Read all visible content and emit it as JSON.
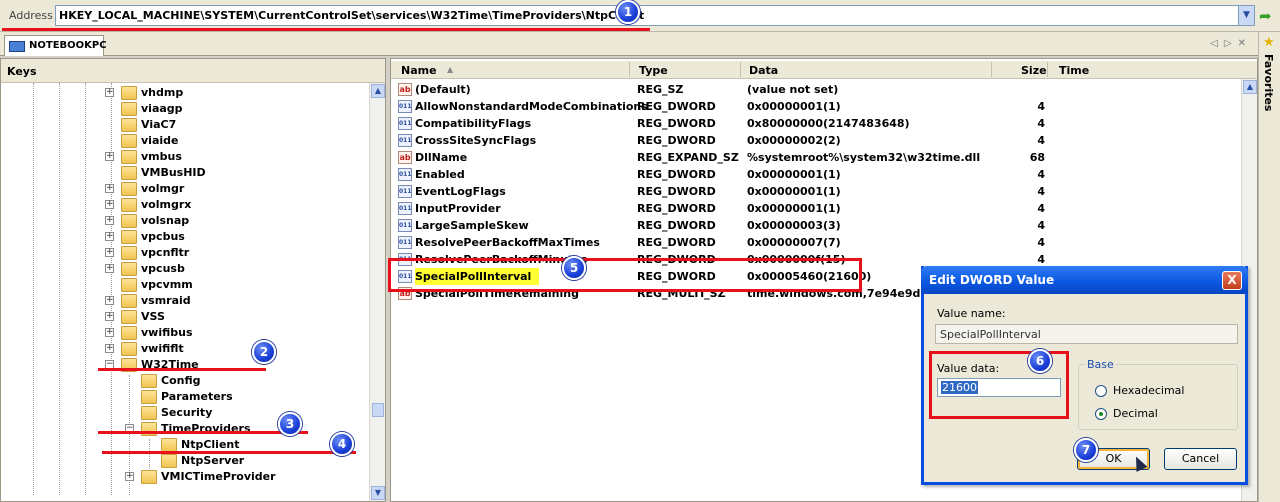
{
  "address": {
    "label": "Address",
    "path": "HKEY_LOCAL_MACHINE\\SYSTEM\\CurrentControlSet\\services\\W32Time\\TimeProviders\\NtpClient"
  },
  "tab": {
    "label": "NOTEBOOKPC"
  },
  "favorites": {
    "label": "Favorites"
  },
  "keys": {
    "title": "Keys",
    "items": [
      {
        "label": "vhdmp",
        "expander": "+"
      },
      {
        "label": "viaagp",
        "expander": ""
      },
      {
        "label": "ViaC7",
        "expander": ""
      },
      {
        "label": "viaide",
        "expander": ""
      },
      {
        "label": "vmbus",
        "expander": "+"
      },
      {
        "label": "VMBusHID",
        "expander": ""
      },
      {
        "label": "volmgr",
        "expander": "+"
      },
      {
        "label": "volmgrx",
        "expander": "+"
      },
      {
        "label": "volsnap",
        "expander": "+"
      },
      {
        "label": "vpcbus",
        "expander": "+"
      },
      {
        "label": "vpcnfltr",
        "expander": "+"
      },
      {
        "label": "vpcusb",
        "expander": "+"
      },
      {
        "label": "vpcvmm",
        "expander": ""
      },
      {
        "label": "vsmraid",
        "expander": "+"
      },
      {
        "label": "VSS",
        "expander": "+"
      },
      {
        "label": "vwifibus",
        "expander": "+"
      },
      {
        "label": "vwififlt",
        "expander": "+"
      },
      {
        "label": "W32Time",
        "expander": "−"
      },
      {
        "label": "Config",
        "expander": ""
      },
      {
        "label": "Parameters",
        "expander": ""
      },
      {
        "label": "Security",
        "expander": ""
      },
      {
        "label": "TimeProviders",
        "expander": "−"
      },
      {
        "label": "NtpClient",
        "expander": ""
      },
      {
        "label": "NtpServer",
        "expander": ""
      },
      {
        "label": "VMICTimeProvider",
        "expander": "+"
      }
    ]
  },
  "values": {
    "headers": {
      "name": "Name",
      "type": "Type",
      "data": "Data",
      "size": "Size",
      "time": "Time"
    },
    "sort_arrow": "▲",
    "rows": [
      {
        "icon": "ab",
        "name": "(Default)",
        "type": "REG_SZ",
        "data": "(value not set)",
        "size": ""
      },
      {
        "icon": "01",
        "name": "AllowNonstandardModeCombinations",
        "type": "REG_DWORD",
        "data": "0x00000001(1)",
        "size": "4"
      },
      {
        "icon": "01",
        "name": "CompatibilityFlags",
        "type": "REG_DWORD",
        "data": "0x80000000(2147483648)",
        "size": "4"
      },
      {
        "icon": "01",
        "name": "CrossSiteSyncFlags",
        "type": "REG_DWORD",
        "data": "0x00000002(2)",
        "size": "4"
      },
      {
        "icon": "ab",
        "name": "DllName",
        "type": "REG_EXPAND_SZ",
        "data": "%systemroot%\\system32\\w32time.dll",
        "size": "68"
      },
      {
        "icon": "01",
        "name": "Enabled",
        "type": "REG_DWORD",
        "data": "0x00000001(1)",
        "size": "4"
      },
      {
        "icon": "01",
        "name": "EventLogFlags",
        "type": "REG_DWORD",
        "data": "0x00000001(1)",
        "size": "4"
      },
      {
        "icon": "01",
        "name": "InputProvider",
        "type": "REG_DWORD",
        "data": "0x00000001(1)",
        "size": "4"
      },
      {
        "icon": "01",
        "name": "LargeSampleSkew",
        "type": "REG_DWORD",
        "data": "0x00000003(3)",
        "size": "4"
      },
      {
        "icon": "01",
        "name": "ResolvePeerBackoffMaxTimes",
        "type": "REG_DWORD",
        "data": "0x00000007(7)",
        "size": "4"
      },
      {
        "icon": "01",
        "name": "ResolvePeerBackoffMinutes",
        "type": "REG_DWORD",
        "data": "0x0000000f(15)",
        "size": "4"
      },
      {
        "icon": "01",
        "name": "SpecialPollInterval",
        "type": "REG_DWORD",
        "data": "0x00005460(21600)",
        "size": ""
      },
      {
        "icon": "ab",
        "name": "SpecialPollTimeRemaining",
        "type": "REG_MULTI_SZ",
        "data": "time.windows.com,7e94e9d",
        "size": ""
      }
    ]
  },
  "dialog": {
    "title": "Edit DWORD Value",
    "close_glyph": "X",
    "value_name_label": "Value name:",
    "value_name": "SpecialPollInterval",
    "value_data_label": "Value data:",
    "value_data": "21600",
    "base_label": "Base",
    "hex_label": "Hexadecimal",
    "dec_label": "Decimal",
    "ok_label": "OK",
    "cancel_label": "Cancel"
  },
  "annotations": [
    "1",
    "2",
    "3",
    "4",
    "5",
    "6",
    "7"
  ],
  "colors": {
    "annotation_red": "#e8101a",
    "marker_blue": "#1a3fd8",
    "highlight_yellow": "#ffff33",
    "dialog_title_blue": "#0a56e0"
  }
}
